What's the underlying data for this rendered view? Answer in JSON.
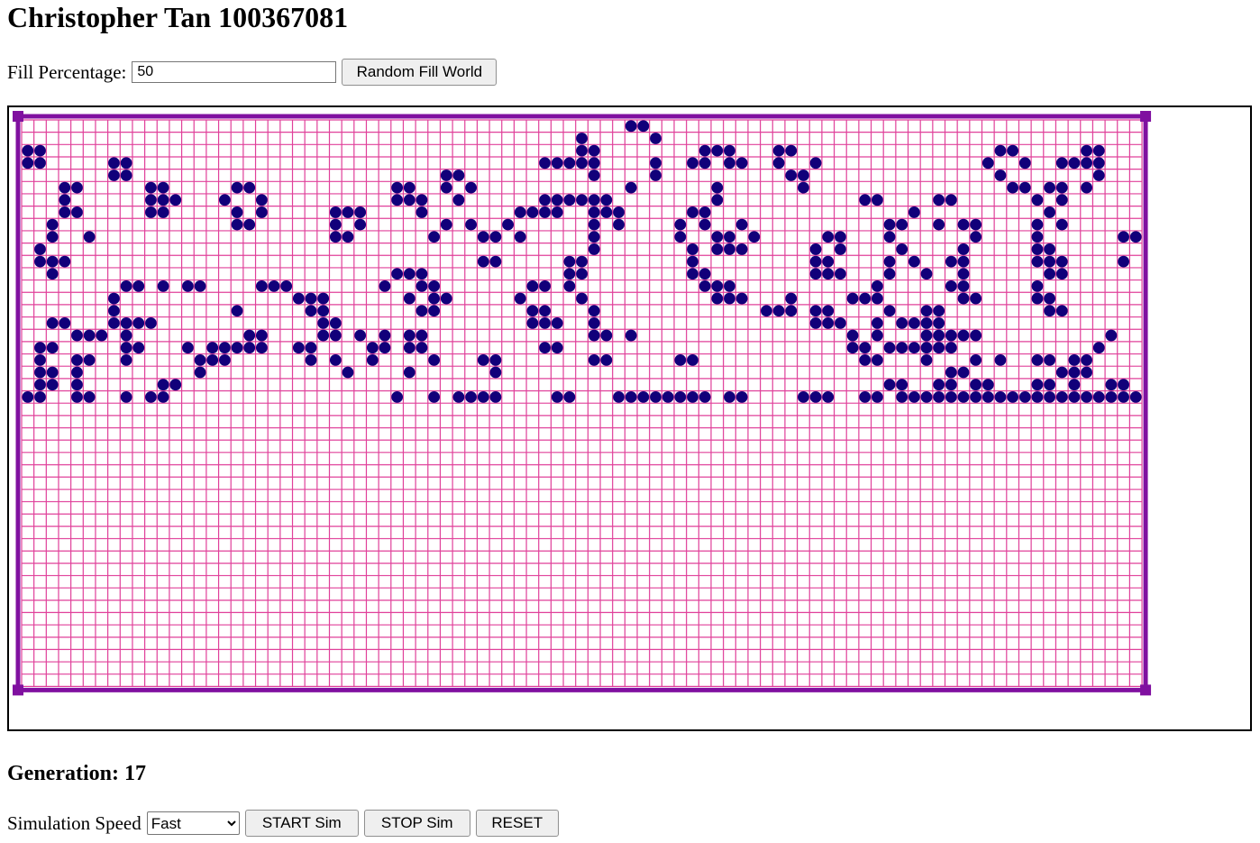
{
  "header": {
    "title": "Christopher Tan 100367081"
  },
  "fill": {
    "label": "Fill Percentage:",
    "value": "50",
    "button_label": "Random Fill World"
  },
  "world": {
    "cols": 91,
    "rows": 46,
    "colors": {
      "grid": "#e0409a",
      "border": "#8010a0",
      "cell": "#11007a",
      "outline": "#000000"
    },
    "live_cells": [
      [
        0,
        49
      ],
      [
        0,
        50
      ],
      [
        1,
        45
      ],
      [
        1,
        51
      ],
      [
        2,
        0
      ],
      [
        2,
        1
      ],
      [
        2,
        45
      ],
      [
        2,
        46
      ],
      [
        2,
        55
      ],
      [
        2,
        56
      ],
      [
        2,
        57
      ],
      [
        2,
        61
      ],
      [
        2,
        62
      ],
      [
        2,
        79
      ],
      [
        2,
        80
      ],
      [
        2,
        86
      ],
      [
        2,
        87
      ],
      [
        3,
        0
      ],
      [
        3,
        1
      ],
      [
        3,
        7
      ],
      [
        3,
        8
      ],
      [
        3,
        42
      ],
      [
        3,
        43
      ],
      [
        3,
        44
      ],
      [
        3,
        45
      ],
      [
        3,
        46
      ],
      [
        3,
        51
      ],
      [
        3,
        54
      ],
      [
        3,
        55
      ],
      [
        3,
        57
      ],
      [
        3,
        58
      ],
      [
        3,
        61
      ],
      [
        3,
        64
      ],
      [
        3,
        78
      ],
      [
        3,
        81
      ],
      [
        3,
        84
      ],
      [
        3,
        85
      ],
      [
        3,
        86
      ],
      [
        3,
        87
      ],
      [
        4,
        7
      ],
      [
        4,
        8
      ],
      [
        4,
        34
      ],
      [
        4,
        35
      ],
      [
        4,
        46
      ],
      [
        4,
        51
      ],
      [
        4,
        62
      ],
      [
        4,
        63
      ],
      [
        4,
        79
      ],
      [
        4,
        87
      ],
      [
        5,
        3
      ],
      [
        5,
        4
      ],
      [
        5,
        10
      ],
      [
        5,
        11
      ],
      [
        5,
        17
      ],
      [
        5,
        18
      ],
      [
        5,
        30
      ],
      [
        5,
        31
      ],
      [
        5,
        34
      ],
      [
        5,
        36
      ],
      [
        5,
        49
      ],
      [
        5,
        56
      ],
      [
        5,
        63
      ],
      [
        5,
        80
      ],
      [
        5,
        81
      ],
      [
        5,
        83
      ],
      [
        5,
        84
      ],
      [
        5,
        86
      ],
      [
        6,
        3
      ],
      [
        6,
        10
      ],
      [
        6,
        11
      ],
      [
        6,
        12
      ],
      [
        6,
        16
      ],
      [
        6,
        19
      ],
      [
        6,
        30
      ],
      [
        6,
        31
      ],
      [
        6,
        32
      ],
      [
        6,
        35
      ],
      [
        6,
        42
      ],
      [
        6,
        43
      ],
      [
        6,
        44
      ],
      [
        6,
        45
      ],
      [
        6,
        46
      ],
      [
        6,
        47
      ],
      [
        6,
        56
      ],
      [
        6,
        68
      ],
      [
        6,
        69
      ],
      [
        6,
        74
      ],
      [
        6,
        75
      ],
      [
        6,
        82
      ],
      [
        6,
        84
      ],
      [
        7,
        3
      ],
      [
        7,
        4
      ],
      [
        7,
        10
      ],
      [
        7,
        11
      ],
      [
        7,
        17
      ],
      [
        7,
        19
      ],
      [
        7,
        25
      ],
      [
        7,
        26
      ],
      [
        7,
        27
      ],
      [
        7,
        32
      ],
      [
        7,
        40
      ],
      [
        7,
        41
      ],
      [
        7,
        42
      ],
      [
        7,
        43
      ],
      [
        7,
        46
      ],
      [
        7,
        47
      ],
      [
        7,
        48
      ],
      [
        7,
        54
      ],
      [
        7,
        55
      ],
      [
        7,
        72
      ],
      [
        7,
        83
      ],
      [
        8,
        2
      ],
      [
        8,
        17
      ],
      [
        8,
        18
      ],
      [
        8,
        25
      ],
      [
        8,
        27
      ],
      [
        8,
        34
      ],
      [
        8,
        36
      ],
      [
        8,
        39
      ],
      [
        8,
        46
      ],
      [
        8,
        48
      ],
      [
        8,
        53
      ],
      [
        8,
        55
      ],
      [
        8,
        58
      ],
      [
        8,
        70
      ],
      [
        8,
        71
      ],
      [
        8,
        74
      ],
      [
        8,
        76
      ],
      [
        8,
        77
      ],
      [
        8,
        82
      ],
      [
        8,
        84
      ],
      [
        9,
        2
      ],
      [
        9,
        5
      ],
      [
        9,
        25
      ],
      [
        9,
        26
      ],
      [
        9,
        33
      ],
      [
        9,
        37
      ],
      [
        9,
        38
      ],
      [
        9,
        40
      ],
      [
        9,
        46
      ],
      [
        9,
        53
      ],
      [
        9,
        56
      ],
      [
        9,
        57
      ],
      [
        9,
        59
      ],
      [
        9,
        65
      ],
      [
        9,
        66
      ],
      [
        9,
        70
      ],
      [
        9,
        77
      ],
      [
        9,
        82
      ],
      [
        9,
        89
      ],
      [
        9,
        90
      ],
      [
        9,
        91
      ],
      [
        10,
        1
      ],
      [
        10,
        46
      ],
      [
        10,
        54
      ],
      [
        10,
        56
      ],
      [
        10,
        57
      ],
      [
        10,
        58
      ],
      [
        10,
        64
      ],
      [
        10,
        66
      ],
      [
        10,
        71
      ],
      [
        10,
        76
      ],
      [
        10,
        82
      ],
      [
        10,
        83
      ],
      [
        11,
        1
      ],
      [
        11,
        2
      ],
      [
        11,
        3
      ],
      [
        11,
        37
      ],
      [
        11,
        38
      ],
      [
        11,
        44
      ],
      [
        11,
        45
      ],
      [
        11,
        54
      ],
      [
        11,
        64
      ],
      [
        11,
        65
      ],
      [
        11,
        70
      ],
      [
        11,
        72
      ],
      [
        11,
        75
      ],
      [
        11,
        76
      ],
      [
        11,
        82
      ],
      [
        11,
        83
      ],
      [
        11,
        84
      ],
      [
        11,
        89
      ],
      [
        12,
        2
      ],
      [
        12,
        30
      ],
      [
        12,
        31
      ],
      [
        12,
        32
      ],
      [
        12,
        44
      ],
      [
        12,
        45
      ],
      [
        12,
        54
      ],
      [
        12,
        55
      ],
      [
        12,
        64
      ],
      [
        12,
        65
      ],
      [
        12,
        66
      ],
      [
        12,
        70
      ],
      [
        12,
        73
      ],
      [
        12,
        76
      ],
      [
        12,
        83
      ],
      [
        12,
        84
      ],
      [
        13,
        8
      ],
      [
        13,
        9
      ],
      [
        13,
        11
      ],
      [
        13,
        13
      ],
      [
        13,
        14
      ],
      [
        13,
        19
      ],
      [
        13,
        20
      ],
      [
        13,
        21
      ],
      [
        13,
        29
      ],
      [
        13,
        32
      ],
      [
        13,
        33
      ],
      [
        13,
        41
      ],
      [
        13,
        42
      ],
      [
        13,
        44
      ],
      [
        13,
        55
      ],
      [
        13,
        56
      ],
      [
        13,
        57
      ],
      [
        13,
        69
      ],
      [
        13,
        75
      ],
      [
        13,
        76
      ],
      [
        13,
        82
      ],
      [
        14,
        7
      ],
      [
        14,
        22
      ],
      [
        14,
        23
      ],
      [
        14,
        24
      ],
      [
        14,
        31
      ],
      [
        14,
        33
      ],
      [
        14,
        34
      ],
      [
        14,
        40
      ],
      [
        14,
        45
      ],
      [
        14,
        56
      ],
      [
        14,
        57
      ],
      [
        14,
        58
      ],
      [
        14,
        62
      ],
      [
        14,
        67
      ],
      [
        14,
        68
      ],
      [
        14,
        69
      ],
      [
        14,
        76
      ],
      [
        14,
        77
      ],
      [
        14,
        82
      ],
      [
        14,
        83
      ],
      [
        15,
        7
      ],
      [
        15,
        17
      ],
      [
        15,
        23
      ],
      [
        15,
        24
      ],
      [
        15,
        32
      ],
      [
        15,
        33
      ],
      [
        15,
        41
      ],
      [
        15,
        42
      ],
      [
        15,
        46
      ],
      [
        15,
        60
      ],
      [
        15,
        61
      ],
      [
        15,
        62
      ],
      [
        15,
        64
      ],
      [
        15,
        65
      ],
      [
        15,
        70
      ],
      [
        15,
        73
      ],
      [
        15,
        74
      ],
      [
        15,
        83
      ],
      [
        15,
        84
      ],
      [
        16,
        2
      ],
      [
        16,
        3
      ],
      [
        16,
        7
      ],
      [
        16,
        8
      ],
      [
        16,
        9
      ],
      [
        16,
        10
      ],
      [
        16,
        24
      ],
      [
        16,
        25
      ],
      [
        16,
        41
      ],
      [
        16,
        42
      ],
      [
        16,
        43
      ],
      [
        16,
        46
      ],
      [
        16,
        64
      ],
      [
        16,
        65
      ],
      [
        16,
        66
      ],
      [
        16,
        69
      ],
      [
        16,
        71
      ],
      [
        16,
        72
      ],
      [
        16,
        73
      ],
      [
        16,
        74
      ],
      [
        17,
        4
      ],
      [
        17,
        5
      ],
      [
        17,
        6
      ],
      [
        17,
        8
      ],
      [
        17,
        18
      ],
      [
        17,
        19
      ],
      [
        17,
        24
      ],
      [
        17,
        25
      ],
      [
        17,
        27
      ],
      [
        17,
        29
      ],
      [
        17,
        31
      ],
      [
        17,
        32
      ],
      [
        17,
        46
      ],
      [
        17,
        47
      ],
      [
        17,
        49
      ],
      [
        17,
        67
      ],
      [
        17,
        69
      ],
      [
        17,
        73
      ],
      [
        17,
        74
      ],
      [
        17,
        75
      ],
      [
        17,
        76
      ],
      [
        17,
        77
      ],
      [
        17,
        88
      ],
      [
        18,
        1
      ],
      [
        18,
        2
      ],
      [
        18,
        8
      ],
      [
        18,
        9
      ],
      [
        18,
        13
      ],
      [
        18,
        15
      ],
      [
        18,
        16
      ],
      [
        18,
        17
      ],
      [
        18,
        18
      ],
      [
        18,
        19
      ],
      [
        18,
        22
      ],
      [
        18,
        23
      ],
      [
        18,
        28
      ],
      [
        18,
        29
      ],
      [
        18,
        31
      ],
      [
        18,
        32
      ],
      [
        18,
        42
      ],
      [
        18,
        43
      ],
      [
        18,
        67
      ],
      [
        18,
        68
      ],
      [
        18,
        70
      ],
      [
        18,
        71
      ],
      [
        18,
        72
      ],
      [
        18,
        73
      ],
      [
        18,
        74
      ],
      [
        18,
        75
      ],
      [
        18,
        87
      ],
      [
        19,
        1
      ],
      [
        19,
        4
      ],
      [
        19,
        5
      ],
      [
        19,
        8
      ],
      [
        19,
        14
      ],
      [
        19,
        15
      ],
      [
        19,
        16
      ],
      [
        19,
        23
      ],
      [
        19,
        25
      ],
      [
        19,
        28
      ],
      [
        19,
        33
      ],
      [
        19,
        37
      ],
      [
        19,
        38
      ],
      [
        19,
        46
      ],
      [
        19,
        47
      ],
      [
        19,
        53
      ],
      [
        19,
        54
      ],
      [
        19,
        68
      ],
      [
        19,
        69
      ],
      [
        19,
        73
      ],
      [
        19,
        77
      ],
      [
        19,
        79
      ],
      [
        19,
        82
      ],
      [
        19,
        83
      ],
      [
        19,
        85
      ],
      [
        19,
        86
      ],
      [
        20,
        1
      ],
      [
        20,
        2
      ],
      [
        20,
        4
      ],
      [
        20,
        14
      ],
      [
        20,
        26
      ],
      [
        20,
        31
      ],
      [
        20,
        38
      ],
      [
        20,
        38
      ],
      [
        20,
        75
      ],
      [
        20,
        76
      ],
      [
        20,
        84
      ],
      [
        20,
        85
      ],
      [
        20,
        86
      ],
      [
        21,
        1
      ],
      [
        21,
        2
      ],
      [
        21,
        4
      ],
      [
        21,
        11
      ],
      [
        21,
        12
      ],
      [
        21,
        70
      ],
      [
        21,
        71
      ],
      [
        21,
        74
      ],
      [
        21,
        75
      ],
      [
        21,
        77
      ],
      [
        21,
        78
      ],
      [
        21,
        82
      ],
      [
        21,
        83
      ],
      [
        21,
        85
      ],
      [
        21,
        88
      ],
      [
        21,
        89
      ],
      [
        22,
        0
      ],
      [
        22,
        1
      ],
      [
        22,
        4
      ],
      [
        22,
        5
      ],
      [
        22,
        8
      ],
      [
        22,
        10
      ],
      [
        22,
        11
      ],
      [
        22,
        30
      ],
      [
        22,
        33
      ],
      [
        22,
        35
      ],
      [
        22,
        36
      ],
      [
        22,
        37
      ],
      [
        22,
        38
      ],
      [
        22,
        43
      ],
      [
        22,
        44
      ],
      [
        22,
        48
      ],
      [
        22,
        49
      ],
      [
        22,
        50
      ],
      [
        22,
        51
      ],
      [
        22,
        52
      ],
      [
        22,
        53
      ],
      [
        22,
        54
      ],
      [
        22,
        55
      ],
      [
        22,
        57
      ],
      [
        22,
        58
      ],
      [
        22,
        63
      ],
      [
        22,
        64
      ],
      [
        22,
        65
      ],
      [
        22,
        68
      ],
      [
        22,
        69
      ],
      [
        22,
        71
      ],
      [
        22,
        72
      ],
      [
        22,
        73
      ],
      [
        22,
        74
      ],
      [
        22,
        75
      ],
      [
        22,
        76
      ],
      [
        22,
        77
      ],
      [
        22,
        78
      ],
      [
        22,
        79
      ],
      [
        22,
        80
      ],
      [
        22,
        81
      ],
      [
        22,
        82
      ],
      [
        22,
        83
      ],
      [
        22,
        84
      ],
      [
        22,
        85
      ],
      [
        22,
        86
      ],
      [
        22,
        87
      ],
      [
        22,
        88
      ],
      [
        22,
        89
      ],
      [
        22,
        90
      ],
      [
        22,
        91
      ],
      [
        22,
        92
      ]
    ]
  },
  "generation": {
    "label": "Generation:",
    "value": "17"
  },
  "sim": {
    "speed_label": "Simulation Speed",
    "speed_value": "Fast",
    "start_label": "START Sim",
    "stop_label": "STOP Sim",
    "reset_label": "RESET"
  }
}
